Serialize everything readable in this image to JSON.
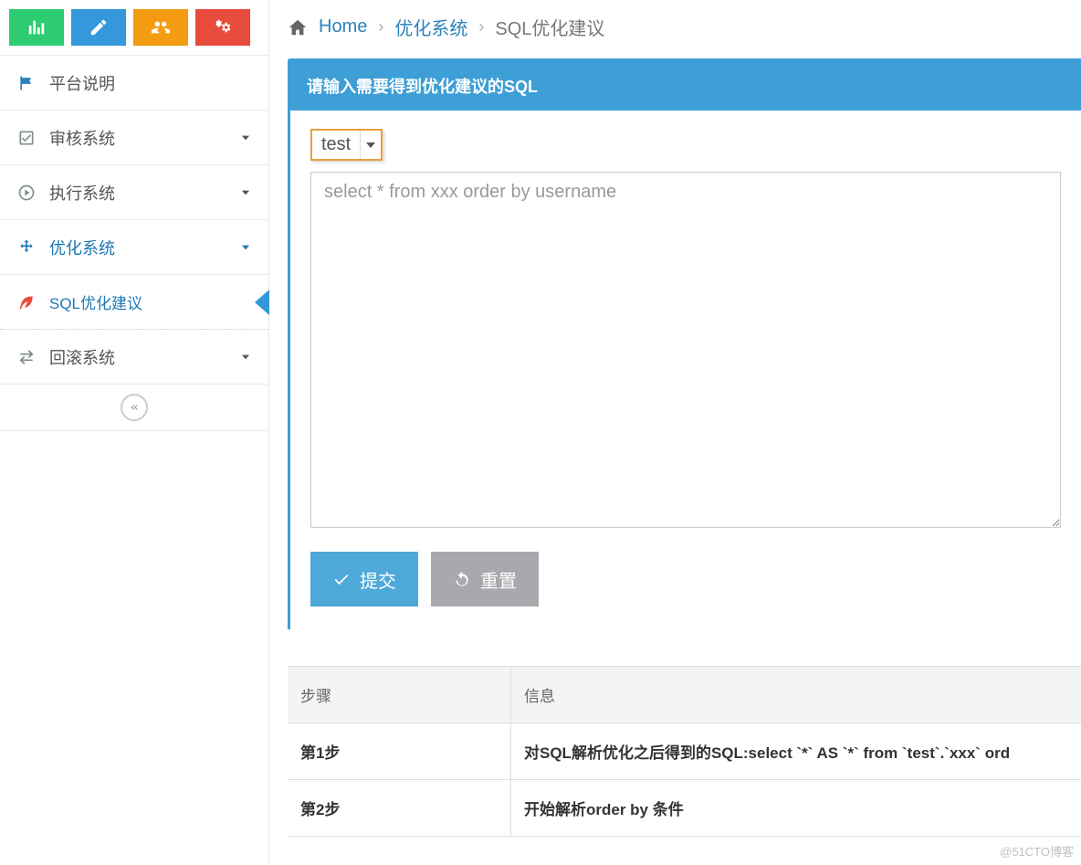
{
  "sidebar": {
    "items": {
      "platform": {
        "label": "平台说明"
      },
      "audit": {
        "label": "审核系统"
      },
      "execute": {
        "label": "执行系统"
      },
      "optimize": {
        "label": "优化系统"
      },
      "sql_advice": {
        "label": "SQL优化建议"
      },
      "rollback": {
        "label": "回滚系统"
      }
    }
  },
  "breadcrumb": {
    "home": "Home",
    "section": "优化系统",
    "current": "SQL优化建议"
  },
  "panel": {
    "title": "请输入需要得到优化建议的SQL",
    "db_selector": {
      "value": "test"
    },
    "sql_value": "select * from xxx order by username",
    "submit": "提交",
    "reset": "重置"
  },
  "table": {
    "headers": {
      "step": "步骤",
      "info": "信息"
    },
    "rows": [
      {
        "step": "第1步",
        "info": "对SQL解析优化之后得到的SQL:select `*` AS `*` from `test`.`xxx` ord"
      },
      {
        "step": "第2步",
        "info": "开始解析order by 条件"
      }
    ]
  },
  "watermark": "@51CTO博客"
}
